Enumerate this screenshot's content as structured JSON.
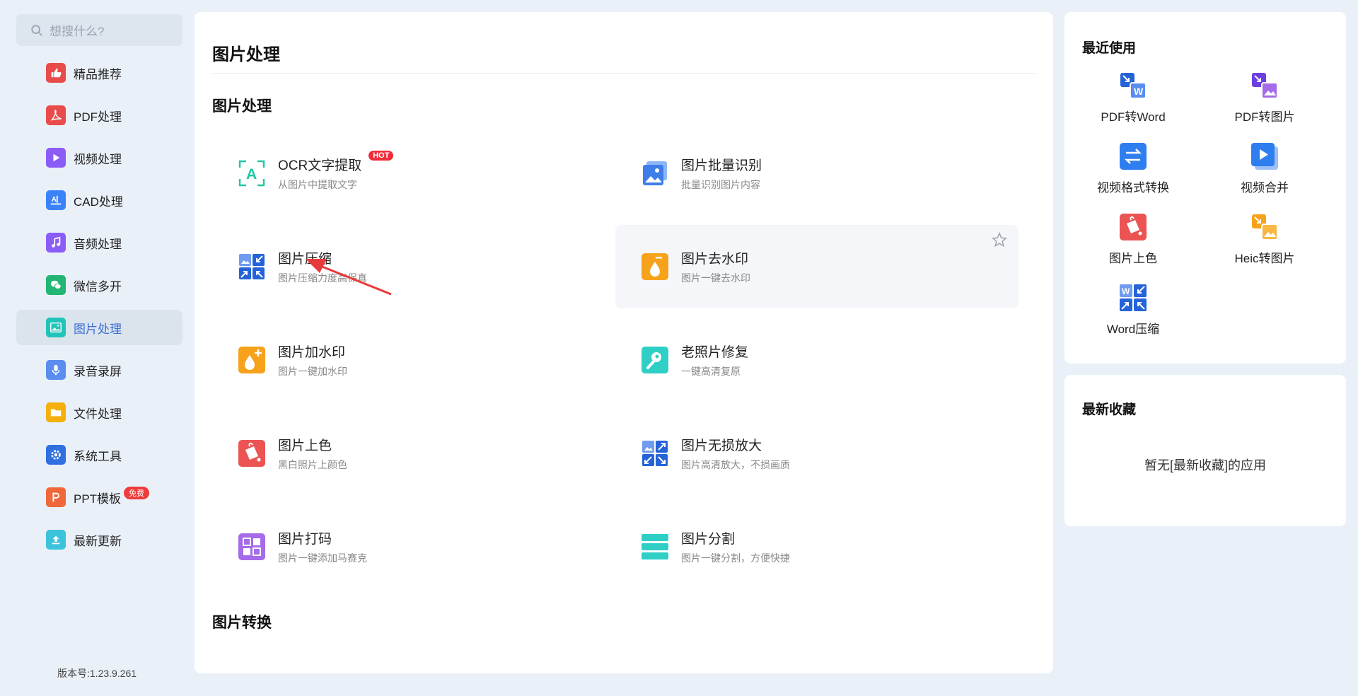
{
  "search": {
    "placeholder": "想搜什么?"
  },
  "sidebar": {
    "items": [
      {
        "label": "精品推荐",
        "icon": "thumbs-up-icon",
        "color": "#e94b4b"
      },
      {
        "label": "PDF处理",
        "icon": "pdf-icon",
        "color": "#e94b4b"
      },
      {
        "label": "视频处理",
        "icon": "video-play-icon",
        "color": "#8b5cf6"
      },
      {
        "label": "CAD处理",
        "icon": "cad-icon",
        "color": "#3b82f6"
      },
      {
        "label": "音频处理",
        "icon": "music-note-icon",
        "color": "#8b5cf6"
      },
      {
        "label": "微信多开",
        "icon": "wechat-icon",
        "color": "#22b573"
      },
      {
        "label": "图片处理",
        "icon": "image-icon",
        "color": "#20c4b8"
      },
      {
        "label": "录音录屏",
        "icon": "microphone-icon",
        "color": "#5b8def"
      },
      {
        "label": "文件处理",
        "icon": "folder-icon",
        "color": "#f5b00e"
      },
      {
        "label": "系统工具",
        "icon": "gear-icon",
        "color": "#2f6fe0"
      },
      {
        "label": "PPT模板",
        "icon": "ppt-icon",
        "color": "#f0683a",
        "badge": "免费"
      },
      {
        "label": "最新更新",
        "icon": "upload-icon",
        "color": "#3cc3dc"
      }
    ],
    "active_index": 6,
    "version": "版本号:1.23.9.261"
  },
  "main": {
    "page_title": "图片处理",
    "sections": [
      {
        "title": "图片处理",
        "tools": [
          {
            "title": "OCR文字提取",
            "desc": "从图片中提取文字",
            "icon": "ocr-icon",
            "badge": "HOT"
          },
          {
            "title": "图片批量识别",
            "desc": "批量识别图片内容",
            "icon": "batch-image-icon"
          },
          {
            "title": "图片压缩",
            "desc": "图片压缩力度高保真",
            "icon": "compress-icon"
          },
          {
            "title": "图片去水印",
            "desc": "图片一键去水印",
            "icon": "remove-watermark-icon"
          },
          {
            "title": "图片加水印",
            "desc": "图片一键加水印",
            "icon": "add-watermark-icon"
          },
          {
            "title": "老照片修复",
            "desc": "一键高清复原",
            "icon": "photo-restore-icon"
          },
          {
            "title": "图片上色",
            "desc": "黑白照片上颜色",
            "icon": "colorize-icon"
          },
          {
            "title": "图片无损放大",
            "desc": "图片高清放大，不损画质",
            "icon": "enlarge-icon"
          },
          {
            "title": "图片打码",
            "desc": "图片一键添加马赛克",
            "icon": "mosaic-icon"
          },
          {
            "title": "图片分割",
            "desc": "图片一键分割，方便快捷",
            "icon": "split-icon"
          }
        ]
      },
      {
        "title": "图片转换",
        "tools": []
      }
    ]
  },
  "recent": {
    "title": "最近使用",
    "items": [
      {
        "label": "PDF转Word",
        "icon": "pdf-to-word-icon"
      },
      {
        "label": "PDF转图片",
        "icon": "pdf-to-image-icon"
      },
      {
        "label": "视频格式转换",
        "icon": "video-convert-icon"
      },
      {
        "label": "视频合并",
        "icon": "video-merge-icon"
      },
      {
        "label": "图片上色",
        "icon": "colorize-icon"
      },
      {
        "label": "Heic转图片",
        "icon": "heic-to-image-icon"
      },
      {
        "label": "Word压缩",
        "icon": "word-compress-icon"
      }
    ]
  },
  "favorites": {
    "title": "最新收藏",
    "empty_text": "暂无[最新收藏]的应用"
  }
}
